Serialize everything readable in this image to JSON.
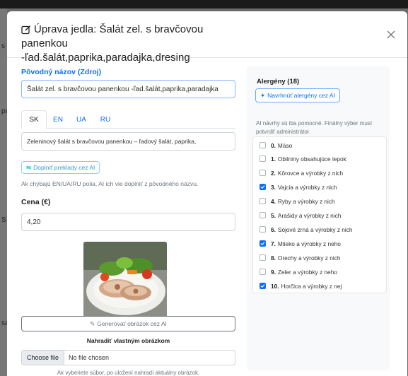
{
  "background": {
    "side_fragments": [
      "s 1",
      "pa",
      "S",
      "sa"
    ]
  },
  "modal": {
    "title_line1": "Úprava jedla: Šalát zel. s bravčovou panenkou",
    "title_line2": "-ľad.šalát,paprika,paradajka,dresing",
    "close_icon": "close-icon",
    "title_icon": "edit-icon"
  },
  "source_name": {
    "label": "Pôvodný názov (Zdroj)",
    "value": "Šalát zel. s bravčovou panenkou -ľad.šalát,paprika,paradajka"
  },
  "lang_tabs": [
    {
      "label": "SK",
      "active": true
    },
    {
      "label": "EN",
      "active": false
    },
    {
      "label": "UA",
      "active": false
    },
    {
      "label": "RU",
      "active": false
    }
  ],
  "translation": {
    "value": "Zeleninový šalát s bravčovou panenkou – ľadový šalát, paprika,"
  },
  "translate_button": "Doplniť preklady cez AI",
  "translate_help": "Ak chýbajú EN/UA/RU polia, AI ich vie doplniť z pôvodného názvu.",
  "price": {
    "label": "Cena (€)",
    "value": "4,20"
  },
  "image_actions": {
    "generate_button": "Generovať obrázok cez AI",
    "replace_label": "Nahradiť vlastným obrázkom",
    "choose_file": "Choose file",
    "no_file": "No file chosen",
    "help": "Ak vyberiete súbor, po uložení nahradí aktuálny obrázok."
  },
  "allergens": {
    "title": "Alergény (18)",
    "suggest_button": "Navrhnúť alergény cez AI",
    "note": "AI návrhy sú iba pomocné. Finálny výber musí potvrdiť administrátor.",
    "items": [
      {
        "num": "0.",
        "label": "Mäso",
        "checked": false
      },
      {
        "num": "1.",
        "label": "Obilniny obsahujúce lepok",
        "checked": false
      },
      {
        "num": "2.",
        "label": "Kôrovce a výrobky z nich",
        "checked": false
      },
      {
        "num": "3.",
        "label": "Vajcia a výrobky z nich",
        "checked": true
      },
      {
        "num": "4.",
        "label": "Ryby a výrobky z nich",
        "checked": false
      },
      {
        "num": "5.",
        "label": "Arašidy a výrobky z nich",
        "checked": false
      },
      {
        "num": "6.",
        "label": "Sójové zrná a výrobky z nich",
        "checked": false
      },
      {
        "num": "7.",
        "label": "Mlieko a výrobky z neho",
        "checked": true
      },
      {
        "num": "8.",
        "label": "Orechy a výrobky z nich",
        "checked": false
      },
      {
        "num": "9.",
        "label": "Zeler a výrobky z neho",
        "checked": false
      },
      {
        "num": "10.",
        "label": "Horčica a výrobky z nej",
        "checked": true
      }
    ]
  },
  "colors": {
    "primary": "#0d6efd",
    "info": "#2aa3c4",
    "muted": "#6c757d"
  }
}
